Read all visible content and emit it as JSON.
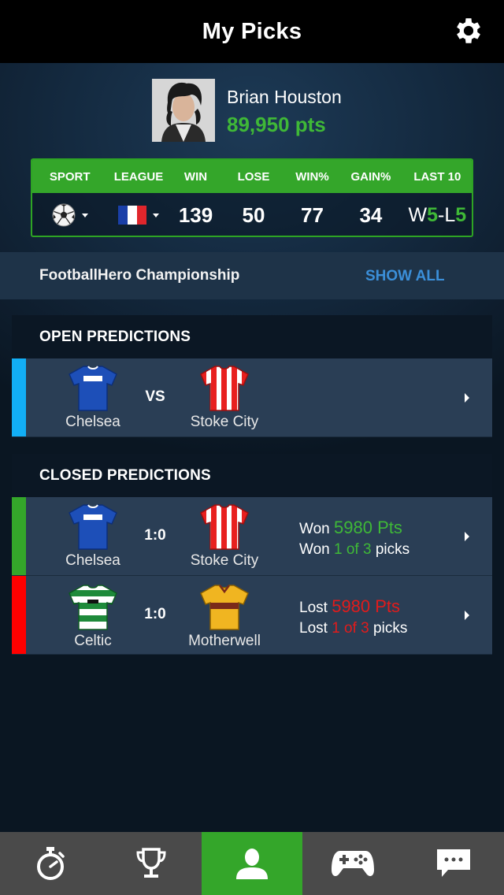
{
  "header": {
    "title": "My Picks",
    "settings_icon": "gear-icon"
  },
  "profile": {
    "name": "Brian Houston",
    "points": "89,950 pts"
  },
  "stats": {
    "headers": [
      "SPORT",
      "LEAGUE",
      "WIN",
      "LOSE",
      "WIN%",
      "GAIN%",
      "LAST 10"
    ],
    "sport_icon": "soccer-ball-icon",
    "league_icon": "france-flag-icon",
    "win": "139",
    "lose": "50",
    "win_pct": "77",
    "gain_pct": "34",
    "last10": {
      "w_prefix": "W",
      "w_value": "5",
      "sep": "-L",
      "l_value": "5"
    },
    "accent": "#34a62a"
  },
  "championship": {
    "title": "FootballHero Championship",
    "show_all": "SHOW ALL"
  },
  "open_predictions": {
    "title": "OPEN PREDICTIONS",
    "items": [
      {
        "home": "Chelsea",
        "away": "Stoke City",
        "middle": "VS",
        "status_color": "#12aef5"
      }
    ]
  },
  "closed_predictions": {
    "title": "CLOSED PREDICTIONS",
    "items": [
      {
        "home": "Chelsea",
        "away": "Stoke City",
        "score": "1:0",
        "line1_label": "Won",
        "line1_pts": "5980 Pts",
        "line2_label": "Won",
        "line2_picks": "1 of 3",
        "line2_suffix": "picks",
        "status_color": "#34a62a"
      },
      {
        "home": "Celtic",
        "away": "Motherwell",
        "score": "1:0",
        "line1_label": "Lost",
        "line1_pts": "5980 Pts",
        "line2_label": "Lost",
        "line2_picks": "1 of 3",
        "line2_suffix": "picks",
        "status_color": "#ff0000"
      }
    ]
  },
  "tabbar": {
    "tabs": [
      {
        "icon": "stopwatch-icon"
      },
      {
        "icon": "trophy-icon"
      },
      {
        "icon": "user-icon",
        "active": true
      },
      {
        "icon": "gamepad-icon"
      },
      {
        "icon": "chat-icon"
      }
    ]
  }
}
